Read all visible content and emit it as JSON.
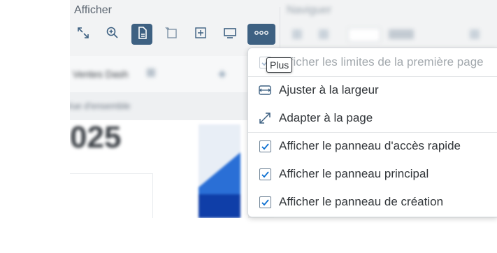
{
  "toolbar": {
    "section_title": "Afficher",
    "right_section_title": "Naviguer",
    "tools": [
      {
        "name": "fit-view",
        "icon": "expand-arrows-icon"
      },
      {
        "name": "zoom",
        "icon": "zoom-in-icon"
      },
      {
        "name": "page-view",
        "icon": "document-icon"
      },
      {
        "name": "new-page",
        "icon": "new-page-icon"
      },
      {
        "name": "add-page",
        "icon": "add-page-icon"
      },
      {
        "name": "present",
        "icon": "screen-icon"
      },
      {
        "name": "more",
        "icon": "more-dots-icon"
      }
    ]
  },
  "document": {
    "header_text": "Ventes Dash",
    "sub_text": "Vue d'ensemble",
    "big_number": "025"
  },
  "tooltip": {
    "text": "Plus"
  },
  "menu": {
    "items": [
      {
        "label": "Afficher les limites de la première page",
        "checked": true,
        "disabled": true
      },
      {
        "label": "Ajuster à la largeur",
        "icon": "fit-width-icon"
      },
      {
        "label": "Adapter à la page",
        "icon": "fit-page-icon"
      },
      {
        "label": "Afficher le panneau d'accès rapide",
        "checked": true
      },
      {
        "label": "Afficher le panneau principal",
        "checked": true
      },
      {
        "label": "Afficher le panneau de création",
        "checked": true
      }
    ]
  },
  "colors": {
    "active_tool": "#3e6182",
    "accent_blue": "#2a6fd6",
    "check_color": "#0a6ed1"
  }
}
